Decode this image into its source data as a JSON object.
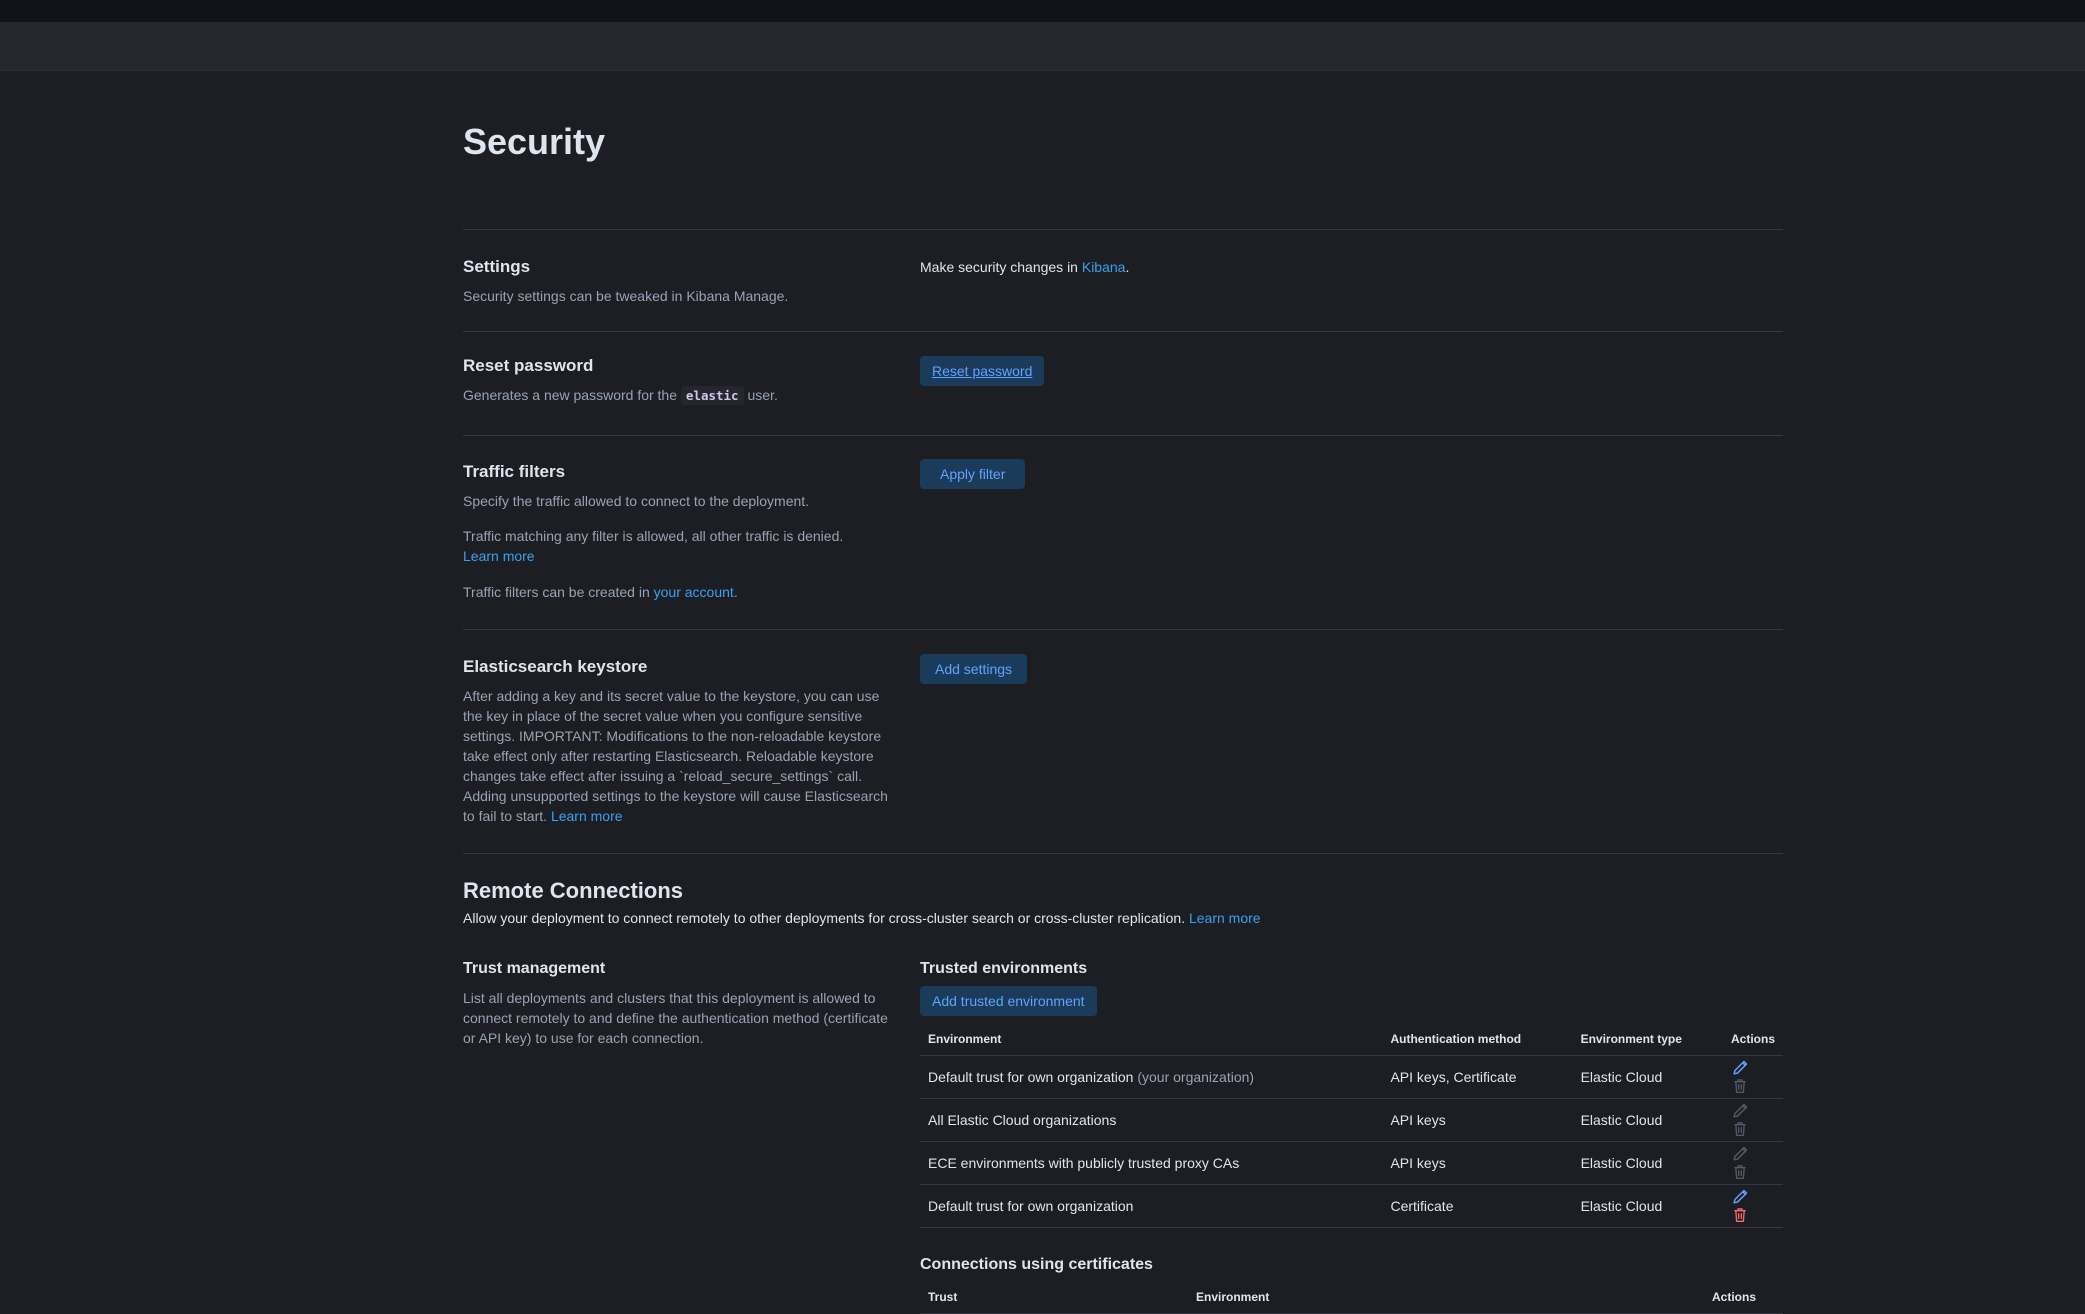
{
  "page": {
    "title": "Security"
  },
  "settings": {
    "title": "Settings",
    "desc": "Security settings can be tweaked in Kibana Manage.",
    "right_prefix": "Make security changes in ",
    "right_link": "Kibana",
    "right_suffix": "."
  },
  "reset_password": {
    "title": "Reset password",
    "desc_prefix": "Generates a new password for the ",
    "desc_code": "elastic",
    "desc_suffix": " user.",
    "button": "Reset password"
  },
  "traffic_filters": {
    "title": "Traffic filters",
    "desc1": "Specify the traffic allowed to connect to the deployment.",
    "desc2": "Traffic matching any filter is allowed, all other traffic is denied.",
    "learn_more": "Learn more",
    "desc3_prefix": "Traffic filters can be created in ",
    "desc3_link": "your account",
    "desc3_suffix": ".",
    "button": "Apply filter"
  },
  "keystore": {
    "title": "Elasticsearch keystore",
    "desc": "After adding a key and its secret value to the keystore, you can use the key in place of the secret value when you configure sensitive settings. IMPORTANT: Modifications to the non-reloadable keystore take effect only after restarting Elasticsearch. Reloadable keystore changes take effect after issuing a `reload_secure_settings` call. Adding unsupported settings to the keystore will cause Elasticsearch to fail to start.",
    "learn_more": "Learn more",
    "button": "Add settings"
  },
  "remote": {
    "title": "Remote Connections",
    "desc": "Allow your deployment to connect remotely to other deployments for cross-cluster search or cross-cluster replication.",
    "learn_more": "Learn more"
  },
  "trust": {
    "title": "Trust management",
    "desc": "List all deployments and clusters that this deployment is allowed to connect remotely to and define the authentication method (certificate or API key) to use for each connection."
  },
  "trusted_envs": {
    "title": "Trusted environments",
    "button": "Add trusted environment",
    "columns": [
      "Environment",
      "Authentication method",
      "Environment type",
      "Actions"
    ],
    "rows": [
      {
        "env": "Default trust for own organization",
        "env_note": "(your organization)",
        "auth": "API keys, Certificate",
        "type": "Elastic Cloud",
        "editable": true,
        "deletable": false
      },
      {
        "env": "All Elastic Cloud organizations",
        "env_note": "",
        "auth": "API keys",
        "type": "Elastic Cloud",
        "editable": false,
        "deletable": false
      },
      {
        "env": "ECE environments with publicly trusted proxy CAs",
        "env_note": "",
        "auth": "API keys",
        "type": "Elastic Cloud",
        "editable": false,
        "deletable": false
      },
      {
        "env": "Default trust for own organization",
        "env_note": "",
        "auth": "Certificate",
        "type": "Elastic Cloud",
        "editable": true,
        "deletable": true
      }
    ]
  },
  "cert_connections": {
    "title": "Connections using certificates",
    "columns": [
      "Trust",
      "Environment",
      "Actions"
    ]
  },
  "colors": {
    "background": "#1d1e24",
    "link": "#36a2ef",
    "button_bg": "#1b3b5b",
    "button_text": "#61a2ff",
    "edit_active": "#61a2ff",
    "delete_active": "#f86b63",
    "icon_disabled": "#535966"
  },
  "icons": {
    "edit": "pencil-icon",
    "delete": "trash-icon"
  }
}
